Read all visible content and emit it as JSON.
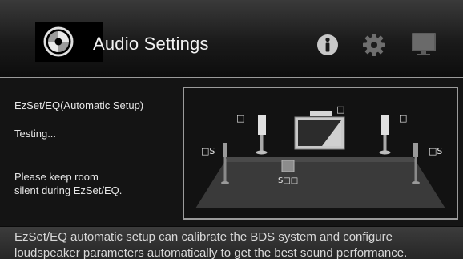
{
  "header": {
    "title": "Audio Settings",
    "icons": [
      "disc-icon",
      "info-icon",
      "gear-icon",
      "tv-icon"
    ]
  },
  "setup": {
    "title": "EzSet/EQ(Automatic Setup)",
    "status": "Testing...",
    "hint_line1": "Please keep room",
    "hint_line2": "silent during EzSet/EQ."
  },
  "speakers": {
    "center": "□",
    "front_left": "□",
    "front_right": "□",
    "surround_left": "□S",
    "surround_right": "□S",
    "subwoofer": "S□□"
  },
  "footer": {
    "line1": "EzSet/EQ automatic setup can calibrate the BDS system and configure",
    "line2": "loudspeaker parameters automatically to get the best sound performance."
  },
  "colors": {
    "panel_border": "#9b9b9b",
    "floor": "#3a3a3a",
    "text": "#e8e8e8"
  }
}
